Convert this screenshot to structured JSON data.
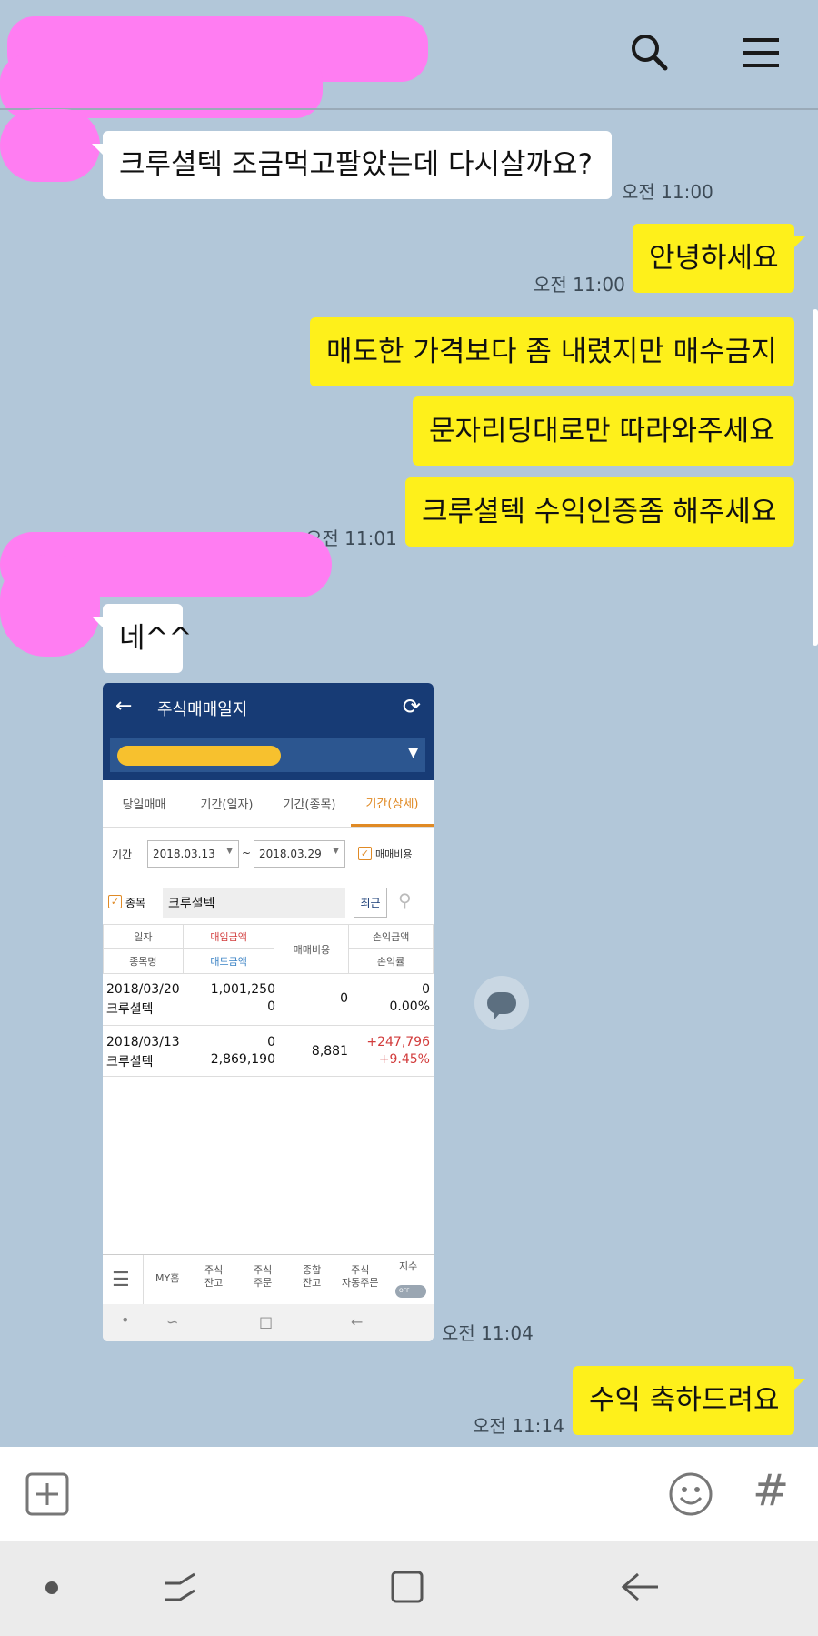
{
  "header": {
    "search_icon": "search-icon",
    "menu_icon": "menu-icon"
  },
  "messages": [
    {
      "id": "m1",
      "side": "in",
      "text": "크루셜텍 조금먹고팔았는데 다시살까요?",
      "time": "오전 11:00"
    },
    {
      "id": "m2",
      "side": "out",
      "text": "안녕하세요",
      "time": "오전 11:00"
    },
    {
      "id": "m3",
      "side": "out",
      "text": "매도한 가격보다 좀 내렸지만 매수금지"
    },
    {
      "id": "m4",
      "side": "out",
      "text": "문자리딩대로만 따라와주세요"
    },
    {
      "id": "m5",
      "side": "out",
      "text": "크루셜텍 수익인증좀 해주세요",
      "time": "오전 11:01"
    },
    {
      "id": "m6",
      "side": "in",
      "text": "네^^"
    },
    {
      "id": "m7",
      "side": "in",
      "type": "image",
      "time": "오전 11:04"
    },
    {
      "id": "m8",
      "side": "out",
      "text": "수익 축하드려요",
      "time": "오전 11:14"
    }
  ],
  "screenshot": {
    "title": "주식매매일지",
    "tabs": [
      "당일매매",
      "기간(일자)",
      "기간(종목)",
      "기간(상세)"
    ],
    "active_tab": 3,
    "period_label": "기간",
    "date_from": "2018.03.13",
    "date_sep": "~",
    "date_to": "2018.03.29",
    "fee_check_label": "매매비용",
    "stock_check_label": "종목",
    "stock_value": "크루셜텍",
    "recent_label": "최근",
    "table_headers": {
      "date": "일자",
      "name": "종목명",
      "buy_amount": "매입금액",
      "sell_amount": "매도금액",
      "fee": "매매비용",
      "pl_amount": "손익금액",
      "pl_rate": "손익률"
    },
    "rows": [
      {
        "date": "2018/03/20",
        "name": "크루셜텍",
        "buy": "1,001,250",
        "sell": "0",
        "fee": "0",
        "pl": "0",
        "rate": "0.00%"
      },
      {
        "date": "2018/03/13",
        "name": "크루셜텍",
        "buy": "0",
        "sell": "2,869,190",
        "fee": "8,881",
        "pl": "+247,796",
        "rate": "+9.45%"
      }
    ],
    "nav": {
      "my_home": "MY홈",
      "stock_balance_1": "주식",
      "stock_balance_2": "잔고",
      "stock_order_1": "주식",
      "stock_order_2": "주문",
      "total_balance_1": "종합",
      "total_balance_2": "잔고",
      "auto_order_1": "주식",
      "auto_order_2": "자동주문",
      "index": "지수",
      "toggle": "OFF"
    }
  },
  "input_bar": {
    "plus_icon": "plus-icon",
    "emoji_icon": "emoji-icon",
    "hash_label": "#"
  },
  "colors": {
    "background": "#b2c7d9",
    "out_bubble": "#fef01b",
    "in_bubble": "#ffffff",
    "redaction": "#ff7df2",
    "app_header": "#173b75"
  }
}
